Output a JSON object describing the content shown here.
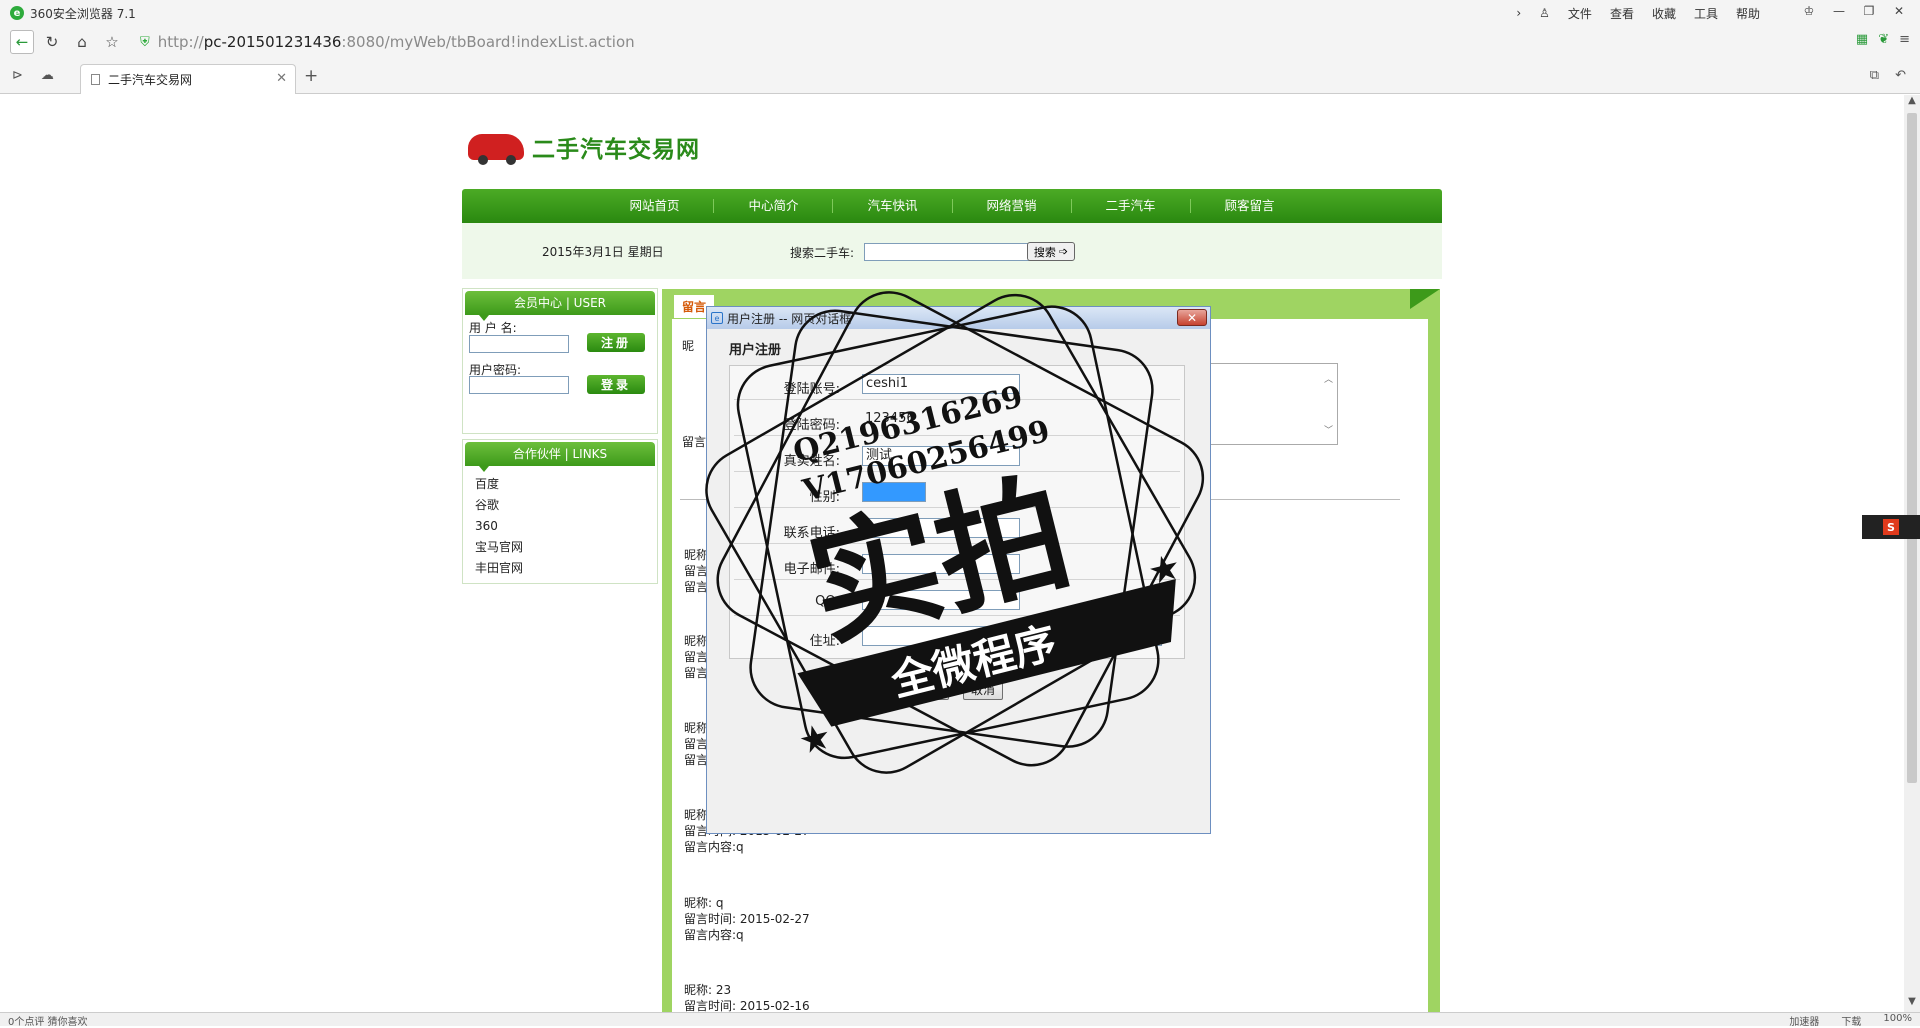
{
  "browser": {
    "app_title": "360安全浏览器 7.1",
    "menus": [
      "文件",
      "查看",
      "收藏",
      "工具",
      "帮助"
    ],
    "url_prefix": "http://",
    "url_host": "pc-201501231436",
    "url_rest": ":8080/myWeb/tbBoard!indexList.action",
    "tab_title": "二手汽车交易网",
    "status_left": "0个点评  猜你喜欢",
    "status_right": [
      "加速器",
      "下载",
      "100%"
    ]
  },
  "site": {
    "name": "二手汽车交易网",
    "nav": [
      "网站首页",
      "中心简介",
      "汽车快讯",
      "网络营销",
      "二手汽车",
      "顾客留言"
    ],
    "date": "2015年3月1日  星期日",
    "search_label": "搜索二手车:",
    "search_button": "搜索"
  },
  "user_box": {
    "title": "会员中心 | USER",
    "username_label": "用 户 名:",
    "password_label": "用户密码:",
    "register_button": "注册",
    "login_button": "登录"
  },
  "links_box": {
    "title": "合作伙伴 | LINKS",
    "links": [
      "百度",
      "谷歌",
      "360",
      "宝马官网",
      "丰田官网"
    ]
  },
  "guestbook": {
    "tab_title": "留言",
    "nick_label": "昵",
    "msg_label": "留言",
    "messages": [
      {
        "lines": [
          "昵称:",
          "留言",
          "留言"
        ]
      },
      {
        "lines": [
          "昵称:",
          "留言",
          "留言"
        ]
      },
      {
        "lines": [
          "昵称:",
          "留言",
          "留言"
        ]
      },
      {
        "lines": [
          "昵称",
          "留言时间: 2015-02-27",
          "留言内容:q"
        ]
      },
      {
        "lines": [
          "昵称: q",
          "留言时间: 2015-02-27",
          "留言内容:q"
        ]
      },
      {
        "lines": [
          "昵称: 23",
          "留言时间: 2015-02-16"
        ]
      }
    ]
  },
  "dialog": {
    "title": "用户注册 -- 网页对话框",
    "form_title": "用户注册",
    "fields": [
      {
        "label": "登陆账号:",
        "value": "ceshi1"
      },
      {
        "label": "登陆密码:",
        "value": "123456"
      },
      {
        "label": "真实姓名:",
        "value": "测试"
      },
      {
        "label": "性别:",
        "value": ""
      },
      {
        "label": "联系电话:",
        "value": ""
      },
      {
        "label": "电子邮件:",
        "value": ""
      },
      {
        "label": "QQ:",
        "value": ""
      },
      {
        "label": "住址:",
        "value": ""
      }
    ],
    "submit_button": "注册",
    "cancel_button": "取消"
  },
  "watermark": {
    "line1": "Q2196316269",
    "line2": "V17060256499",
    "big_text": "实拍",
    "banner": "全微程序"
  },
  "colors": {
    "brand_green": "#2a8a1a",
    "panel_green": "#9fd462",
    "accent_orange": "#d55a0a"
  }
}
